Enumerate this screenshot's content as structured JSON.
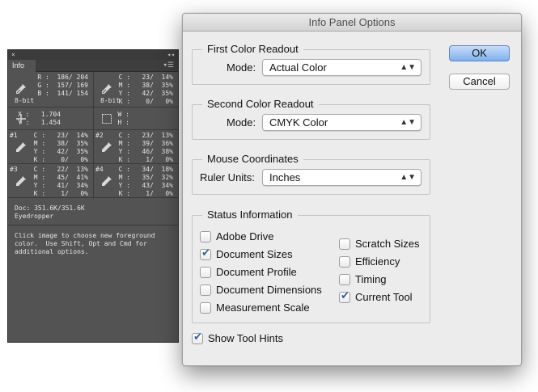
{
  "info_panel": {
    "tab": "Info",
    "close_glyph": "×",
    "collapse_glyph": "◂◂",
    "menu_glyph": "▾☰",
    "rgb": {
      "lines": "R :  186/ 204\nG :  157/ 169\nB :  141/ 154",
      "bits": "8-bit"
    },
    "cmyk": {
      "lines": "C :   23/  14%\nM :   38/  35%\nY :   42/  35%\nK :    0/   0%",
      "bits": "8-bit"
    },
    "xy": {
      "lines": "X :   1.704\nY :   1.454"
    },
    "wh": {
      "lines": "W :\nH :"
    },
    "samples": [
      {
        "num": "#1",
        "lines": "C :   23/  14%\nM :   38/  35%\nY :   42/  35%\nK :    0/   0%"
      },
      {
        "num": "#2",
        "lines": "C :   23/  13%\nM :   39/  36%\nY :   46/  38%\nK :    1/   0%"
      },
      {
        "num": "#3",
        "lines": "C :   22/  13%\nM :   45/  41%\nY :   41/  34%\nK :    1/   0%"
      },
      {
        "num": "#4",
        "lines": "C :   34/  18%\nM :   35/  32%\nY :   43/  34%\nK :    1/   0%"
      }
    ],
    "doc": "Doc: 351.6K/351.6K",
    "tool": "Eyedropper",
    "hint": "Click image to choose new foreground\ncolor.  Use Shift, Opt and Cmd for\nadditional options."
  },
  "dialog": {
    "title": "Info Panel Options",
    "ok_label": "OK",
    "cancel_label": "Cancel",
    "first": {
      "legend": "First Color Readout",
      "mode_label": "Mode:",
      "mode_value": "Actual Color"
    },
    "second": {
      "legend": "Second Color Readout",
      "mode_label": "Mode:",
      "mode_value": "CMYK Color"
    },
    "mouse": {
      "legend": "Mouse Coordinates",
      "units_label": "Ruler Units:",
      "units_value": "Inches"
    },
    "status": {
      "legend": "Status Information",
      "left": [
        {
          "label": "Adobe Drive",
          "checked": false
        },
        {
          "label": "Document Sizes",
          "checked": true
        },
        {
          "label": "Document Profile",
          "checked": false
        },
        {
          "label": "Document Dimensions",
          "checked": false
        },
        {
          "label": "Measurement Scale",
          "checked": false
        }
      ],
      "right": [
        {
          "label": "Scratch Sizes",
          "checked": false
        },
        {
          "label": "Efficiency",
          "checked": false
        },
        {
          "label": "Timing",
          "checked": false
        },
        {
          "label": "Current Tool",
          "checked": true
        }
      ]
    },
    "tool_hints": {
      "label": "Show Tool Hints",
      "checked": true
    },
    "select_arrows": "▲▼"
  }
}
